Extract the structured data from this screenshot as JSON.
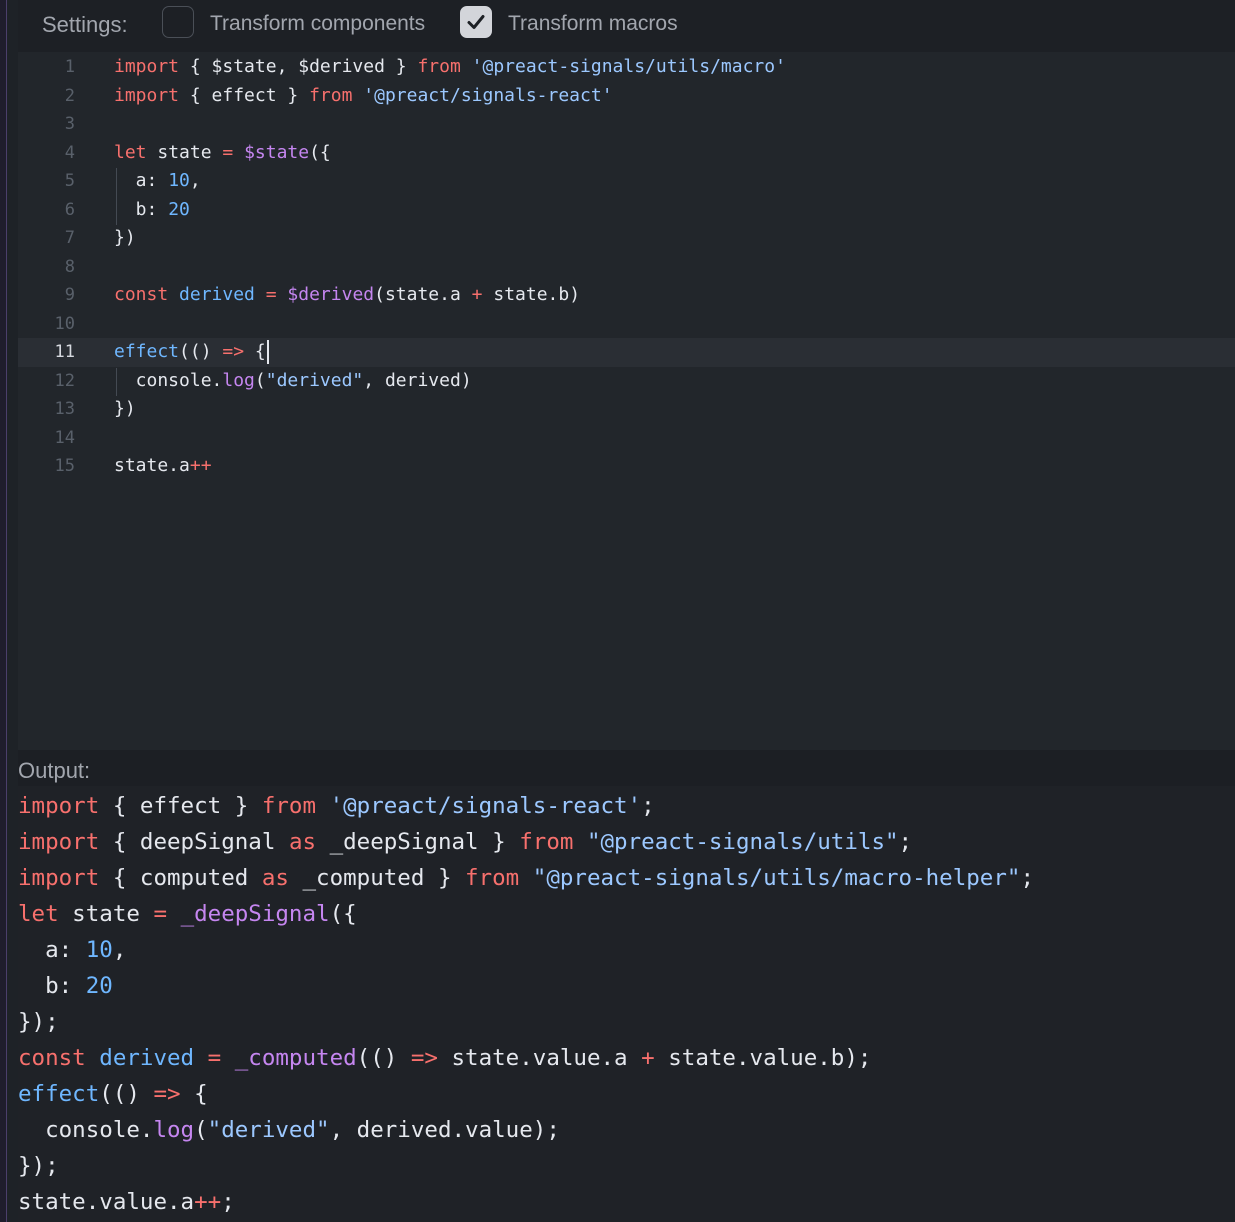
{
  "settings": {
    "label": "Settings:",
    "options": [
      {
        "label": "Transform components",
        "checked": false
      },
      {
        "label": "Transform macros",
        "checked": true
      }
    ]
  },
  "editor": {
    "active_line": 11,
    "lines": [
      {
        "n": "1",
        "tokens": [
          {
            "t": "import",
            "c": "kw"
          },
          {
            "t": " { $state, $derived } ",
            "c": "plain"
          },
          {
            "t": "from",
            "c": "kw"
          },
          {
            "t": " ",
            "c": "plain"
          },
          {
            "t": "'@preact-signals/utils/macro'",
            "c": "str"
          }
        ]
      },
      {
        "n": "2",
        "tokens": [
          {
            "t": "import",
            "c": "kw"
          },
          {
            "t": " { effect } ",
            "c": "plain"
          },
          {
            "t": "from",
            "c": "kw"
          },
          {
            "t": " ",
            "c": "plain"
          },
          {
            "t": "'@preact/signals-react'",
            "c": "str"
          }
        ]
      },
      {
        "n": "3",
        "tokens": []
      },
      {
        "n": "4",
        "tokens": [
          {
            "t": "let",
            "c": "kw"
          },
          {
            "t": " state ",
            "c": "plain"
          },
          {
            "t": "=",
            "c": "op"
          },
          {
            "t": " ",
            "c": "plain"
          },
          {
            "t": "$state",
            "c": "fn"
          },
          {
            "t": "({",
            "c": "plain"
          }
        ]
      },
      {
        "n": "5",
        "tokens": [
          {
            "t": "  a: ",
            "c": "plain"
          },
          {
            "t": "10",
            "c": "num"
          },
          {
            "t": ",",
            "c": "plain"
          }
        ]
      },
      {
        "n": "6",
        "tokens": [
          {
            "t": "  b: ",
            "c": "plain"
          },
          {
            "t": "20",
            "c": "num"
          }
        ]
      },
      {
        "n": "7",
        "tokens": [
          {
            "t": "})",
            "c": "plain"
          }
        ]
      },
      {
        "n": "8",
        "tokens": []
      },
      {
        "n": "9",
        "tokens": [
          {
            "t": "const",
            "c": "kw"
          },
          {
            "t": " ",
            "c": "plain"
          },
          {
            "t": "derived",
            "c": "def"
          },
          {
            "t": " ",
            "c": "plain"
          },
          {
            "t": "=",
            "c": "op"
          },
          {
            "t": " ",
            "c": "plain"
          },
          {
            "t": "$derived",
            "c": "fn"
          },
          {
            "t": "(state.a ",
            "c": "plain"
          },
          {
            "t": "+",
            "c": "op"
          },
          {
            "t": " state.b)",
            "c": "plain"
          }
        ]
      },
      {
        "n": "10",
        "tokens": []
      },
      {
        "n": "11",
        "tokens": [
          {
            "t": "effect",
            "c": "def"
          },
          {
            "t": "(() ",
            "c": "plain"
          },
          {
            "t": "=>",
            "c": "op"
          },
          {
            "t": " {",
            "c": "plain"
          }
        ]
      },
      {
        "n": "12",
        "tokens": [
          {
            "t": "  console.",
            "c": "plain"
          },
          {
            "t": "log",
            "c": "fn"
          },
          {
            "t": "(",
            "c": "plain"
          },
          {
            "t": "\"derived\"",
            "c": "str"
          },
          {
            "t": ", derived)",
            "c": "plain"
          }
        ]
      },
      {
        "n": "13",
        "tokens": [
          {
            "t": "})",
            "c": "plain"
          }
        ]
      },
      {
        "n": "14",
        "tokens": []
      },
      {
        "n": "15",
        "tokens": [
          {
            "t": "state.a",
            "c": "plain"
          },
          {
            "t": "++",
            "c": "op"
          }
        ]
      }
    ]
  },
  "output": {
    "label": "Output:",
    "lines": [
      [
        {
          "t": "import",
          "c": "kw"
        },
        {
          "t": " { effect } ",
          "c": "plain"
        },
        {
          "t": "from",
          "c": "kw"
        },
        {
          "t": " ",
          "c": "plain"
        },
        {
          "t": "'@preact/signals-react'",
          "c": "str"
        },
        {
          "t": ";",
          "c": "plain"
        }
      ],
      [
        {
          "t": "import",
          "c": "kw"
        },
        {
          "t": " { deepSignal ",
          "c": "plain"
        },
        {
          "t": "as",
          "c": "kw"
        },
        {
          "t": " _deepSignal } ",
          "c": "plain"
        },
        {
          "t": "from",
          "c": "kw"
        },
        {
          "t": " ",
          "c": "plain"
        },
        {
          "t": "\"@preact-signals/utils\"",
          "c": "str"
        },
        {
          "t": ";",
          "c": "plain"
        }
      ],
      [
        {
          "t": "import",
          "c": "kw"
        },
        {
          "t": " { computed ",
          "c": "plain"
        },
        {
          "t": "as",
          "c": "kw"
        },
        {
          "t": " _computed } ",
          "c": "plain"
        },
        {
          "t": "from",
          "c": "kw"
        },
        {
          "t": " ",
          "c": "plain"
        },
        {
          "t": "\"@preact-signals/utils/macro-helper\"",
          "c": "str"
        },
        {
          "t": ";",
          "c": "plain"
        }
      ],
      [
        {
          "t": "let",
          "c": "kw"
        },
        {
          "t": " state ",
          "c": "plain"
        },
        {
          "t": "=",
          "c": "op"
        },
        {
          "t": " ",
          "c": "plain"
        },
        {
          "t": "_deepSignal",
          "c": "fn"
        },
        {
          "t": "({",
          "c": "plain"
        }
      ],
      [
        {
          "t": "  a: ",
          "c": "plain"
        },
        {
          "t": "10",
          "c": "num"
        },
        {
          "t": ",",
          "c": "plain"
        }
      ],
      [
        {
          "t": "  b: ",
          "c": "plain"
        },
        {
          "t": "20",
          "c": "num"
        }
      ],
      [
        {
          "t": "});",
          "c": "plain"
        }
      ],
      [
        {
          "t": "const",
          "c": "kw"
        },
        {
          "t": " ",
          "c": "plain"
        },
        {
          "t": "derived",
          "c": "def"
        },
        {
          "t": " ",
          "c": "plain"
        },
        {
          "t": "=",
          "c": "op"
        },
        {
          "t": " ",
          "c": "plain"
        },
        {
          "t": "_computed",
          "c": "fn"
        },
        {
          "t": "(() ",
          "c": "plain"
        },
        {
          "t": "=>",
          "c": "op"
        },
        {
          "t": " state.value.a ",
          "c": "plain"
        },
        {
          "t": "+",
          "c": "op"
        },
        {
          "t": " state.value.b);",
          "c": "plain"
        }
      ],
      [
        {
          "t": "effect",
          "c": "def"
        },
        {
          "t": "(() ",
          "c": "plain"
        },
        {
          "t": "=>",
          "c": "op"
        },
        {
          "t": " {",
          "c": "plain"
        }
      ],
      [
        {
          "t": "  console.",
          "c": "plain"
        },
        {
          "t": "log",
          "c": "fn"
        },
        {
          "t": "(",
          "c": "plain"
        },
        {
          "t": "\"derived\"",
          "c": "str"
        },
        {
          "t": ", derived.value);",
          "c": "plain"
        }
      ],
      [
        {
          "t": "});",
          "c": "plain"
        }
      ],
      [
        {
          "t": "state.value.a",
          "c": "plain"
        },
        {
          "t": "++",
          "c": "op"
        },
        {
          "t": ";",
          "c": "plain"
        }
      ]
    ]
  }
}
